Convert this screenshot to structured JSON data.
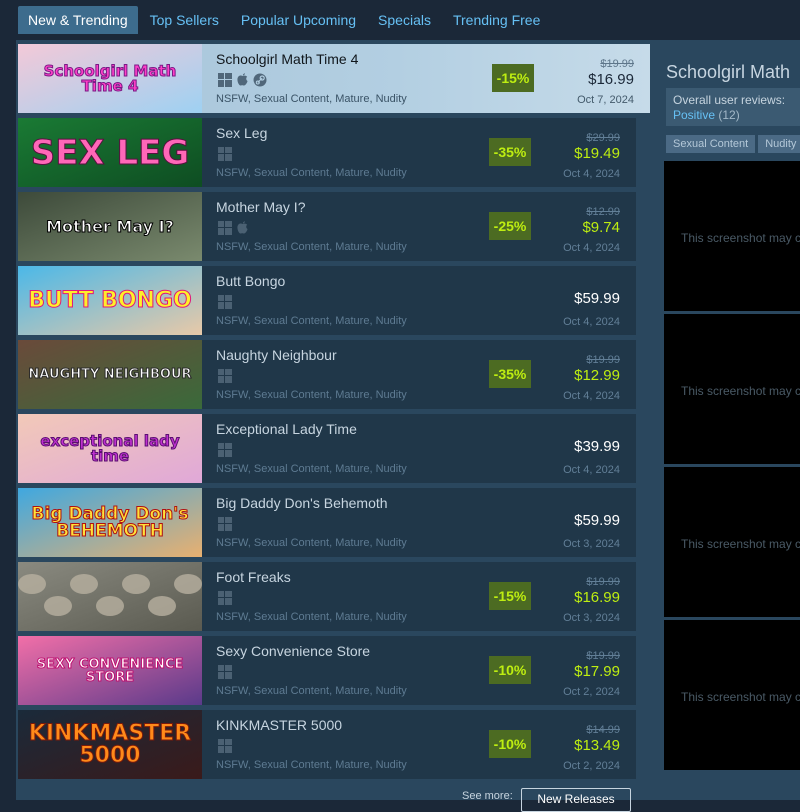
{
  "tabs": [
    "New & Trending",
    "Top Sellers",
    "Popular Upcoming",
    "Specials",
    "Trending Free"
  ],
  "games": [
    {
      "name": "Schoolgirl Math Time 4",
      "platforms": [
        "windows",
        "apple",
        "steam"
      ],
      "tags": "NSFW, Sexual Content, Mature, Nudity",
      "discount": "-15%",
      "original_price": "$19.99",
      "final_price": "$16.99",
      "date": "Oct 7, 2024",
      "capsule_text": "Schoolgirl Math Time 4"
    },
    {
      "name": "Sex Leg",
      "platforms": [
        "windows"
      ],
      "tags": "NSFW, Sexual Content, Mature, Nudity",
      "discount": "-35%",
      "original_price": "$29.99",
      "final_price": "$19.49",
      "date": "Oct 4, 2024",
      "capsule_text": "SEX LEG"
    },
    {
      "name": "Mother May I?",
      "platforms": [
        "windows",
        "apple"
      ],
      "tags": "NSFW, Sexual Content, Mature, Nudity",
      "discount": "-25%",
      "original_price": "$12.99",
      "final_price": "$9.74",
      "date": "Oct 4, 2024",
      "capsule_text": "Mother May I?"
    },
    {
      "name": "Butt Bongo",
      "platforms": [
        "windows"
      ],
      "tags": "NSFW, Sexual Content, Mature, Nudity",
      "discount": "",
      "original_price": "",
      "final_price": "$59.99",
      "date": "Oct 4, 2024",
      "capsule_text": "BUTT BONGO"
    },
    {
      "name": "Naughty Neighbour",
      "platforms": [
        "windows"
      ],
      "tags": "NSFW, Sexual Content, Mature, Nudity",
      "discount": "-35%",
      "original_price": "$19.99",
      "final_price": "$12.99",
      "date": "Oct 4, 2024",
      "capsule_text": "NAUGHTY NEIGHBOUR"
    },
    {
      "name": "Exceptional Lady Time",
      "platforms": [
        "windows"
      ],
      "tags": "NSFW, Sexual Content, Mature, Nudity",
      "discount": "",
      "original_price": "",
      "final_price": "$39.99",
      "date": "Oct 4, 2024",
      "capsule_text": "exceptional lady time"
    },
    {
      "name": "Big Daddy Don's Behemoth",
      "platforms": [
        "windows"
      ],
      "tags": "NSFW, Sexual Content, Mature, Nudity",
      "discount": "",
      "original_price": "",
      "final_price": "$59.99",
      "date": "Oct 3, 2024",
      "capsule_text": "Big Daddy Don's BEHEMOTH"
    },
    {
      "name": "Foot Freaks",
      "platforms": [
        "windows"
      ],
      "tags": "NSFW, Sexual Content, Mature, Nudity",
      "discount": "-15%",
      "original_price": "$19.99",
      "final_price": "$16.99",
      "date": "Oct 3, 2024",
      "capsule_text": ""
    },
    {
      "name": "Sexy Convenience Store",
      "platforms": [
        "windows"
      ],
      "tags": "NSFW, Sexual Content, Mature, Nudity",
      "discount": "-10%",
      "original_price": "$19.99",
      "final_price": "$17.99",
      "date": "Oct 2, 2024",
      "capsule_text": "SEXY CONVENIENCE STORE"
    },
    {
      "name": "KINKMASTER 5000",
      "platforms": [
        "windows"
      ],
      "tags": "NSFW, Sexual Content, Mature, Nudity",
      "discount": "-10%",
      "original_price": "$14.99",
      "final_price": "$13.49",
      "date": "Oct 2, 2024",
      "capsule_text": "KINKMASTER 5000"
    }
  ],
  "see_more": {
    "label": "See more:",
    "button": "New Releases"
  },
  "preview": {
    "title": "Schoolgirl Math",
    "reviews_label": "Overall user reviews:",
    "reviews_value": "Positive",
    "reviews_count": "(12)",
    "tags": [
      "Sexual Content",
      "Nudity"
    ],
    "screenshot_text": "This screenshot may c"
  },
  "colors": {
    "background": "#1b2838",
    "panel": "#2a475e",
    "discount_bg": "#4c6b22",
    "discount_fg": "#beee11",
    "link": "#66c0f4",
    "active_tab": "#3d6c8d"
  }
}
